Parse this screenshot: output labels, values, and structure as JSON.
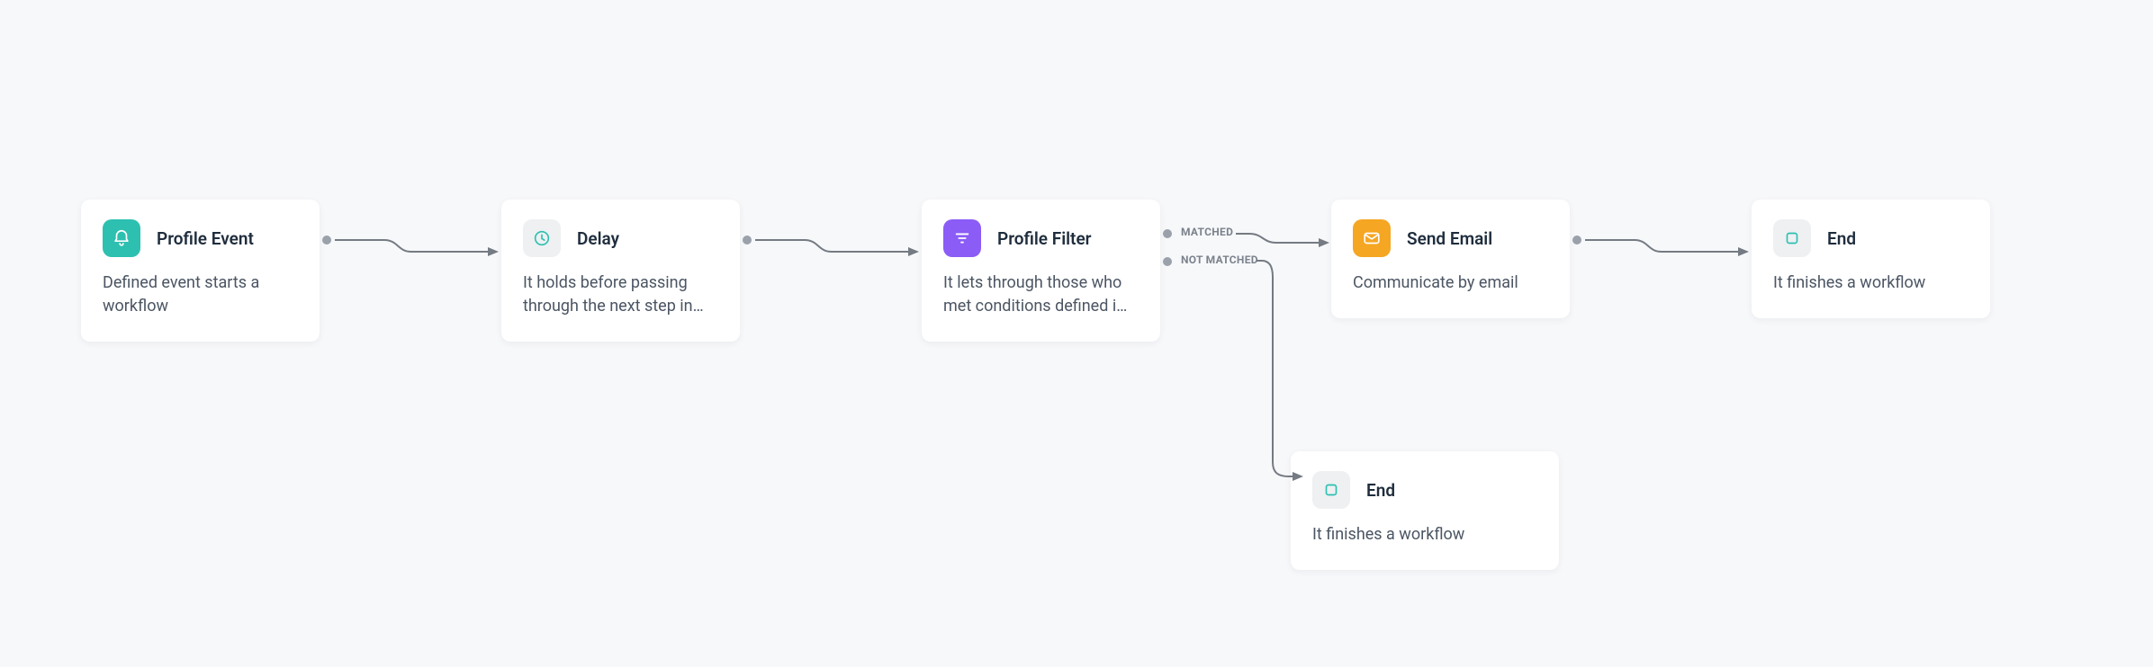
{
  "nodes": {
    "profile_event": {
      "title": "Profile Event",
      "desc": "Defined event starts a workflow"
    },
    "delay": {
      "title": "Delay",
      "desc": "It holds before passing through the next step in…"
    },
    "profile_filter": {
      "title": "Profile Filter",
      "desc": "It lets through those who met conditions defined i…",
      "port_matched": "MATCHED",
      "port_not_matched": "NOT MATCHED"
    },
    "send_email": {
      "title": "Send Email",
      "desc": "Communicate by email"
    },
    "end_top": {
      "title": "End",
      "desc": "It finishes a workflow"
    },
    "end_bottom": {
      "title": "End",
      "desc": "It finishes a workflow"
    }
  },
  "colors": {
    "teal": "#2dc0b0",
    "gray_bg": "#eef0f2",
    "purple": "#8b5cf6",
    "orange": "#f5a623"
  }
}
